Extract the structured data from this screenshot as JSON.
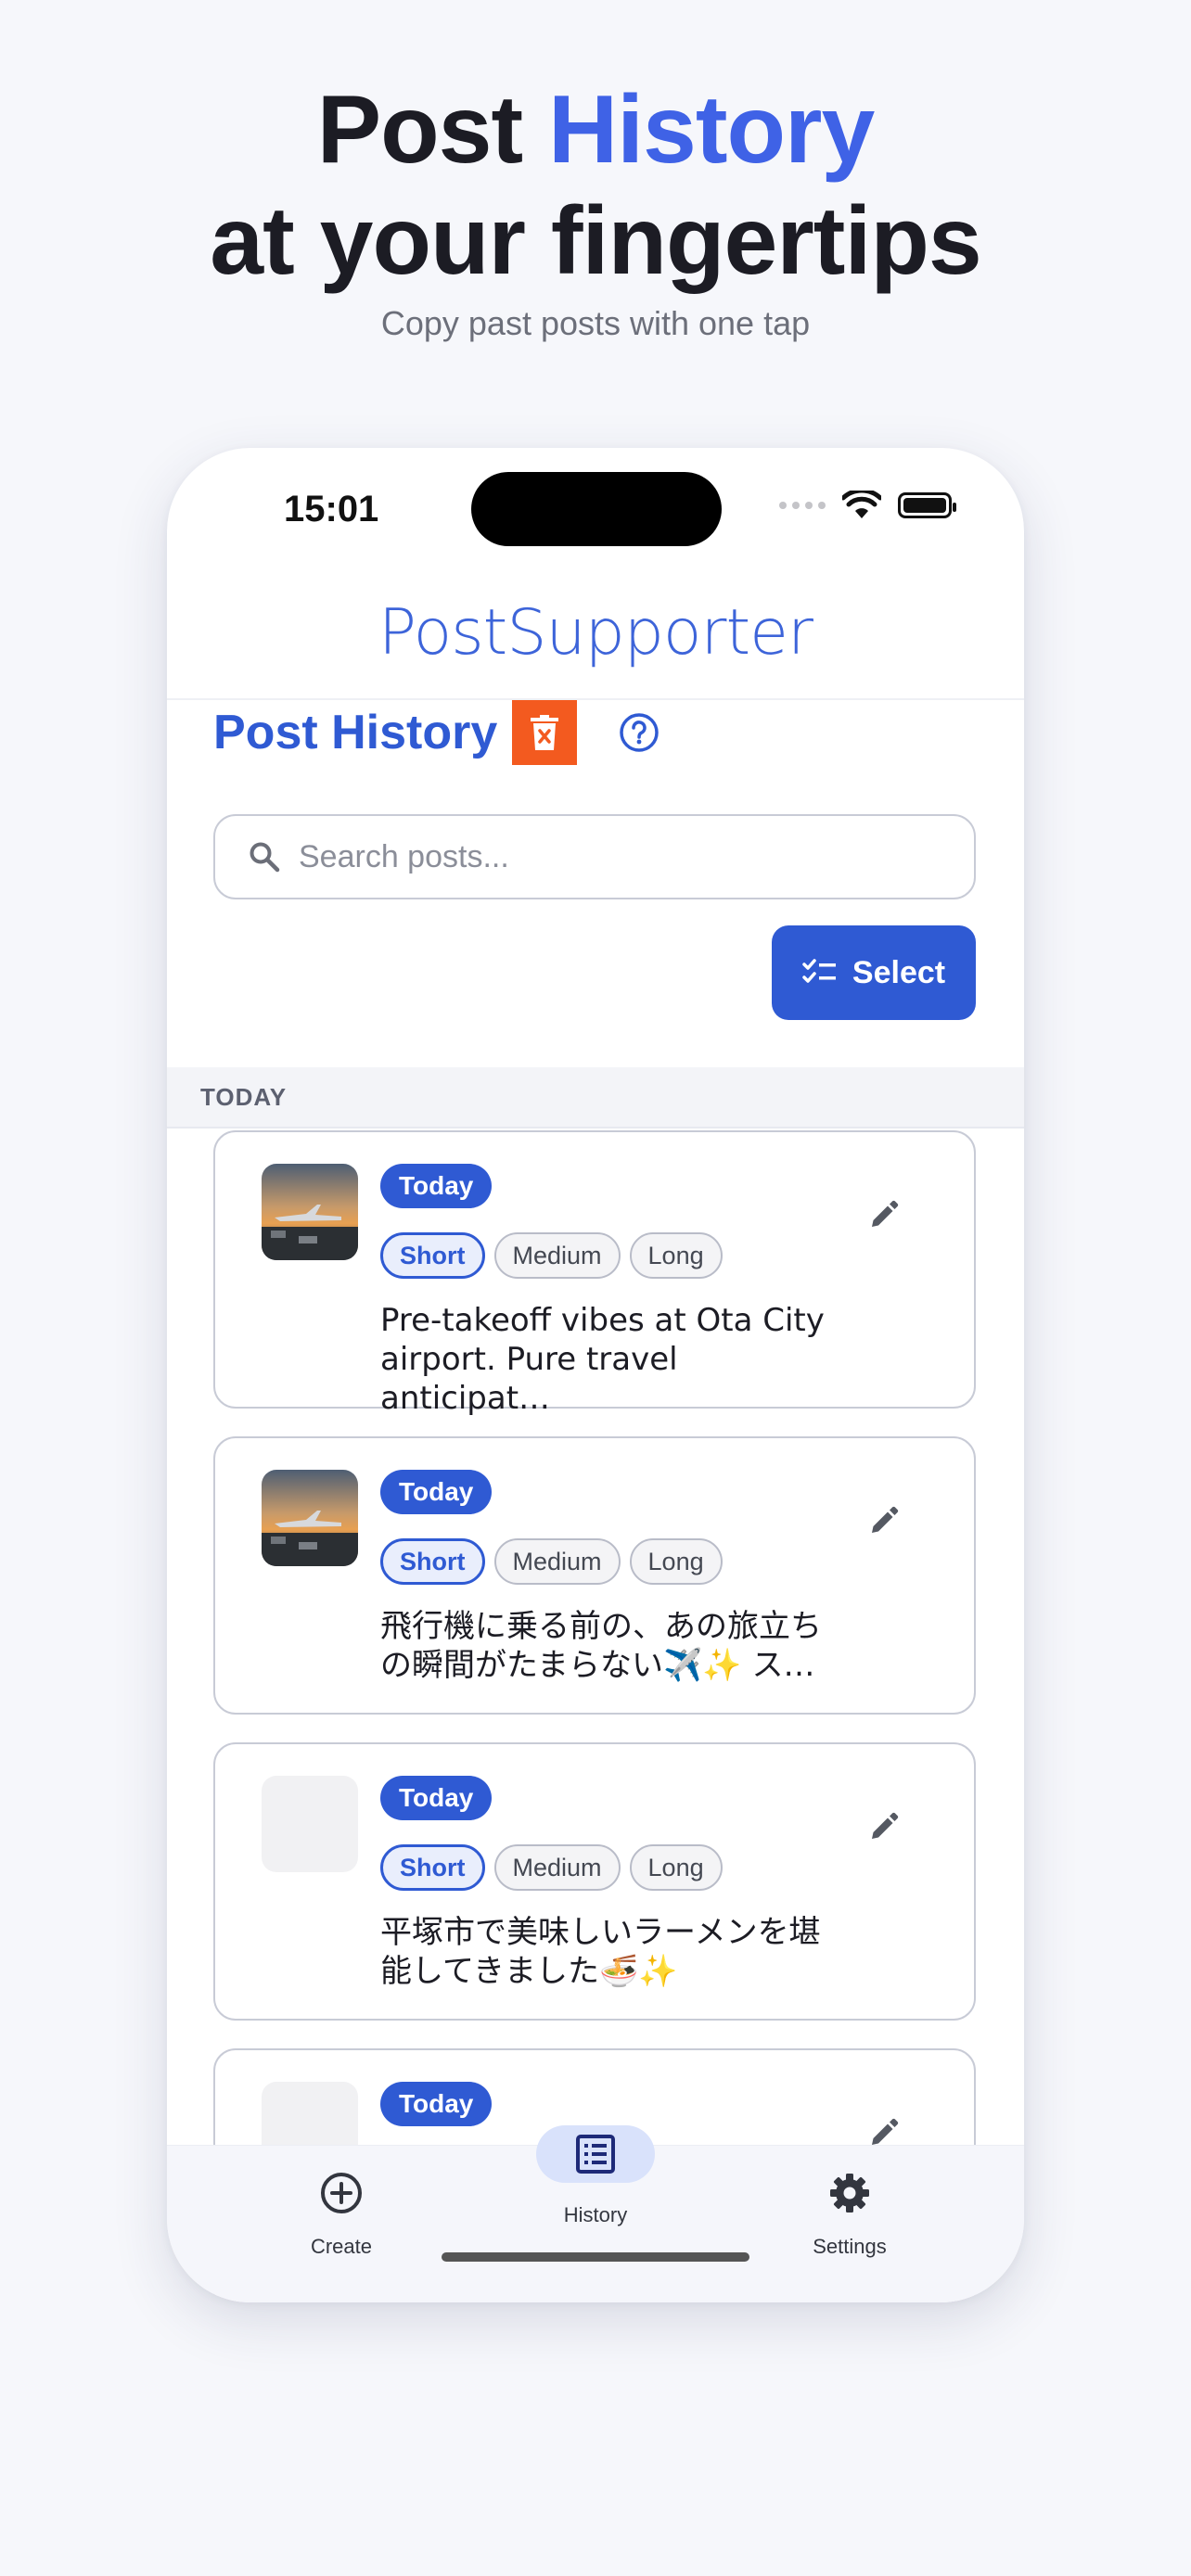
{
  "hero": {
    "line1_prefix": "Post",
    "line1_accent": "History",
    "line2": "at your fingertips",
    "subtitle": "Copy past posts with one tap"
  },
  "status_bar": {
    "time": "15:01"
  },
  "app": {
    "title": "PostSupporter"
  },
  "page": {
    "title": "Post History",
    "delete_icon": "trash-x-icon",
    "help_icon": "help-circle-icon"
  },
  "search": {
    "placeholder": "Search posts..."
  },
  "select_button": {
    "label": "Select"
  },
  "section": {
    "label": "TODAY"
  },
  "cards": [
    {
      "badge": "Today",
      "chips": [
        "Short",
        "Medium",
        "Long"
      ],
      "active_chip": "Short",
      "text": "Pre-takeoff vibes at Ota City airport. Pure travel anticipat…",
      "has_image": true
    },
    {
      "badge": "Today",
      "chips": [
        "Short",
        "Medium",
        "Long"
      ],
      "active_chip": "Short",
      "text": "飛行機に乗る前の、あの旅立ちの瞬間がたまらない✈️✨ ス…",
      "has_image": true
    },
    {
      "badge": "Today",
      "chips": [
        "Short",
        "Medium",
        "Long"
      ],
      "active_chip": "Short",
      "text": "平塚市で美味しいラーメンを堪能してきました🍜✨",
      "has_image": false
    },
    {
      "badge": "Today",
      "has_image": false
    }
  ],
  "tabs": [
    {
      "label": "Create",
      "icon": "plus-circle-icon"
    },
    {
      "label": "History",
      "icon": "list-icon",
      "selected": true
    },
    {
      "label": "Settings",
      "icon": "gear-icon"
    }
  ],
  "colors": {
    "accent": "#2f5ad3",
    "hero_accent": "#3f62e6",
    "delete": "#f35a1f",
    "background": "#f6f7fb"
  }
}
